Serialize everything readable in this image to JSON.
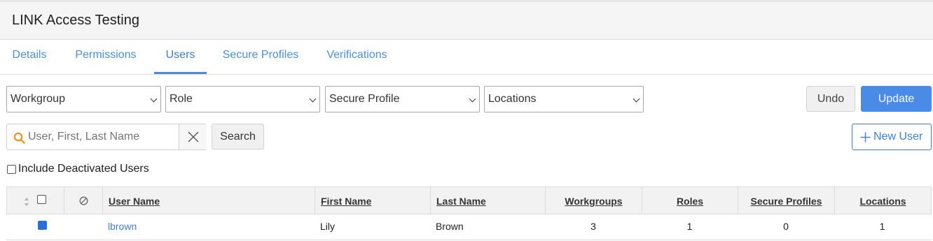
{
  "header": {
    "title": "LINK Access Testing"
  },
  "tabs": [
    {
      "label": "Details"
    },
    {
      "label": "Permissions"
    },
    {
      "label": "Users"
    },
    {
      "label": "Secure Profiles"
    },
    {
      "label": "Verifications"
    }
  ],
  "active_tab": "Users",
  "filters": {
    "workgroup": "Workgroup",
    "role": "Role",
    "secure_profile": "Secure Profile",
    "locations": "Locations"
  },
  "actions": {
    "undo": "Undo",
    "update": "Update",
    "search": "Search",
    "new_user": "New User"
  },
  "search": {
    "placeholder": "User, First, Last Name",
    "value": ""
  },
  "include_deactivated": {
    "label": "Include Deactivated Users",
    "checked": false
  },
  "table": {
    "columns": [
      "User Name",
      "First Name",
      "Last Name",
      "Workgroups",
      "Roles",
      "Secure Profiles",
      "Locations"
    ],
    "rows": [
      {
        "selected": true,
        "user_name": "lbrown",
        "first_name": "Lily",
        "last_name": "Brown",
        "workgroups": "3",
        "roles": "1",
        "secure_profiles": "0",
        "locations": "1"
      }
    ]
  },
  "colors": {
    "accent": "#4a8be8",
    "link": "#3d7fd3",
    "search_icon": "#e8951e"
  },
  "icons": {
    "search": "search-icon",
    "clear": "close-icon",
    "new": "plus-icon",
    "sort": "sort-icon",
    "deactivated": "ban-icon"
  }
}
